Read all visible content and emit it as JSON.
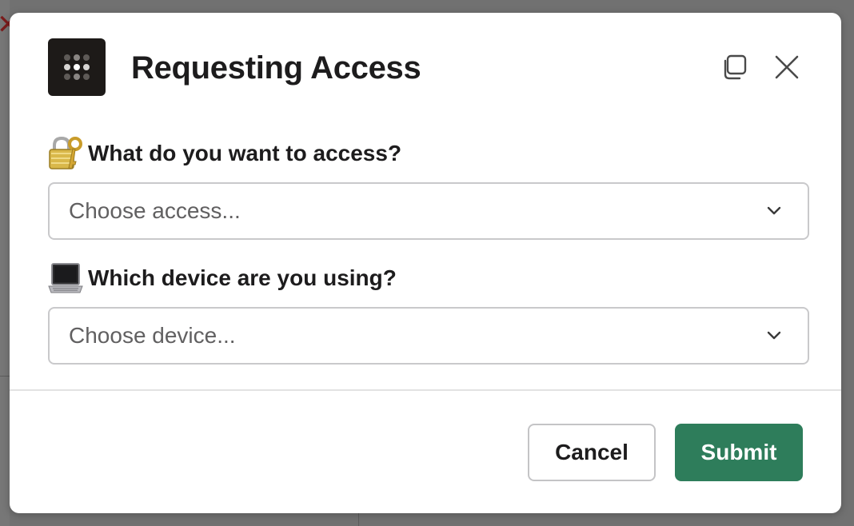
{
  "modal": {
    "title": "Requesting Access",
    "colors": {
      "submit_bg": "#2e7d5b",
      "app_icon_bg": "#1d1a18"
    }
  },
  "fields": [
    {
      "emoji": "lock-with-key-icon",
      "label": "What do you want to access?",
      "placeholder": "Choose access..."
    },
    {
      "emoji": "laptop-icon",
      "label": "Which device are you using?",
      "placeholder": "Choose device..."
    }
  ],
  "footer": {
    "cancel_label": "Cancel",
    "submit_label": "Submit"
  }
}
